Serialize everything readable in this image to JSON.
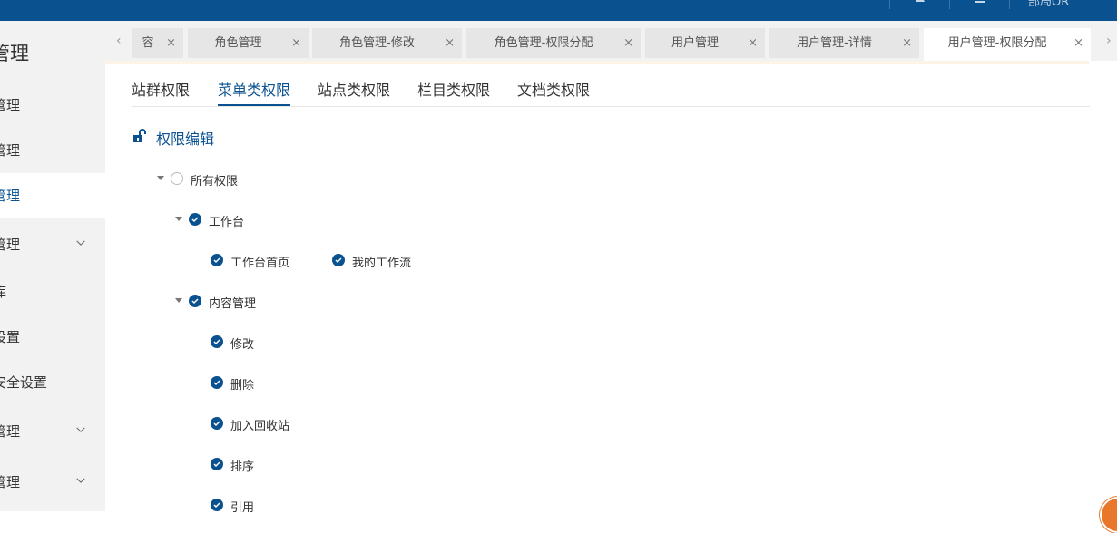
{
  "topbar": {
    "user": "部局OR"
  },
  "sidebar": {
    "title": "管理",
    "items": [
      {
        "label": "管理",
        "active": false,
        "chevron": false
      },
      {
        "label": "管理",
        "active": false,
        "chevron": false
      },
      {
        "label": "管理",
        "active": true,
        "chevron": false
      },
      {
        "label": "管理",
        "active": false,
        "chevron": true
      },
      {
        "label": "库",
        "active": false,
        "chevron": false
      },
      {
        "label": "设置",
        "active": false,
        "chevron": false
      },
      {
        "label": "安全设置",
        "active": false,
        "chevron": false
      },
      {
        "label": "管理",
        "active": false,
        "chevron": true
      },
      {
        "label": "管理",
        "active": false,
        "chevron": true
      }
    ]
  },
  "tabs": [
    {
      "label": "容",
      "close": "×"
    },
    {
      "label": "角色管理",
      "close": "×"
    },
    {
      "label": "角色管理-修改",
      "close": "×"
    },
    {
      "label": "角色管理-权限分配",
      "close": "×"
    },
    {
      "label": "用户管理",
      "close": "×"
    },
    {
      "label": "用户管理-详情",
      "close": "×"
    },
    {
      "label": "用户管理-权限分配",
      "close": "×",
      "active": true
    }
  ],
  "subtabs": [
    {
      "label": "站群权限"
    },
    {
      "label": "菜单类权限",
      "active": true
    },
    {
      "label": "站点类权限"
    },
    {
      "label": "栏目类权限"
    },
    {
      "label": "文档类权限"
    }
  ],
  "section": {
    "title": "权限编辑"
  },
  "tree": {
    "root": "所有权限",
    "n1": "工作台",
    "n1a": "工作台首页",
    "n1b": "我的工作流",
    "n2": "内容管理",
    "n2a": "修改",
    "n2b": "删除",
    "n2c": "加入回收站",
    "n2d": "排序",
    "n2e": "引用"
  },
  "colors": {
    "brand": "#0a5190",
    "accent": "#e8772c"
  }
}
